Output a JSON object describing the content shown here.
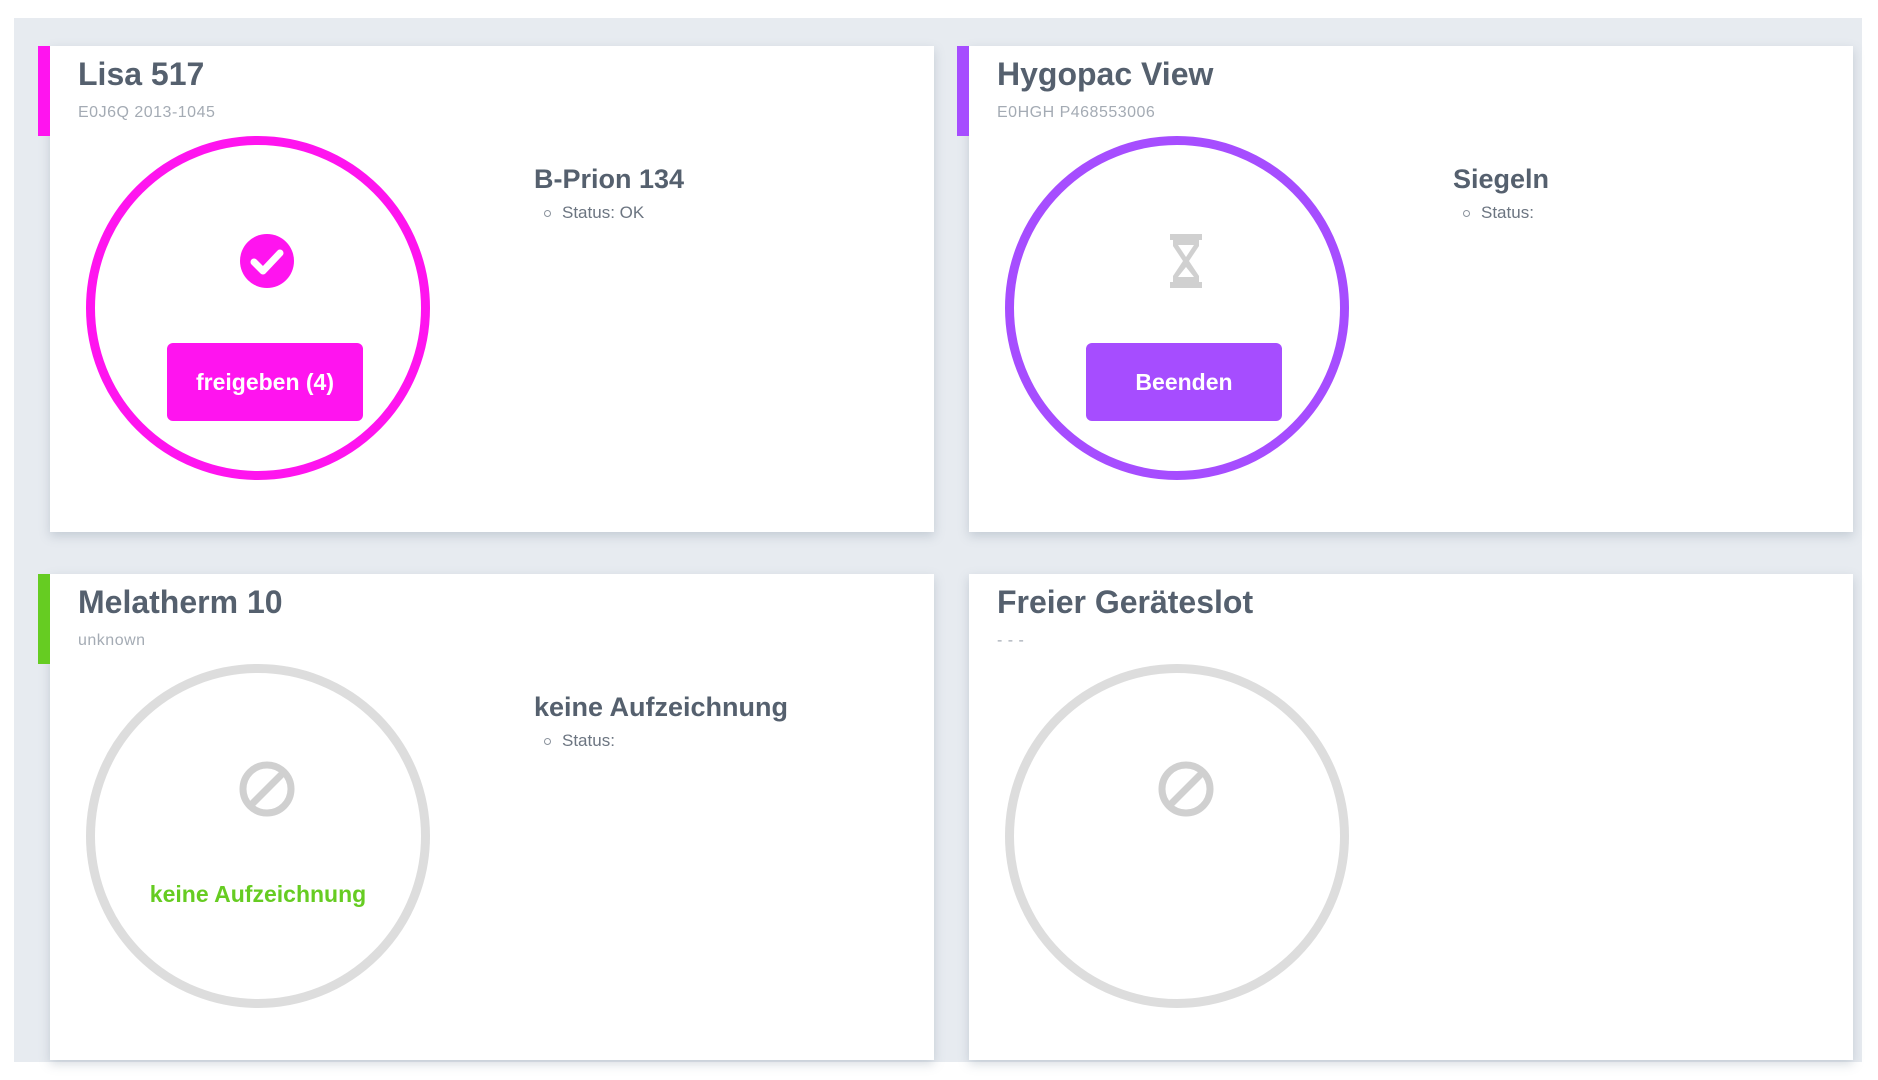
{
  "colors": {
    "magenta": "#ff14ef",
    "purple": "#a64dff",
    "green": "#66cc22",
    "idle_ring": "#dddddd",
    "idle_icon": "#d0d0d0",
    "title_text": "#55606e"
  },
  "cards": [
    {
      "title": "Lisa 517",
      "serial": "E0J6Q 2013-1045",
      "accent": "#ff14ef",
      "state_icon": "check-circle-icon",
      "action_label": "freigeben (4)",
      "program_name": "B-Prion 134",
      "status_label": "Status: OK"
    },
    {
      "title": "Hygopac View",
      "serial": "E0HGH P468553006",
      "accent": "#a64dff",
      "state_icon": "hourglass-icon",
      "action_label": "Beenden",
      "program_name": "Siegeln",
      "status_label": "Status:"
    },
    {
      "title": "Melatherm 10",
      "serial": "unknown",
      "accent": "#66cc22",
      "state_icon": "ban-icon",
      "state_text": "keine Aufzeichnung",
      "program_name": "keine Aufzeichnung",
      "status_label": "Status:"
    },
    {
      "title": "Freier Geräteslot",
      "serial": "- - -",
      "state_icon": "ban-icon"
    }
  ]
}
